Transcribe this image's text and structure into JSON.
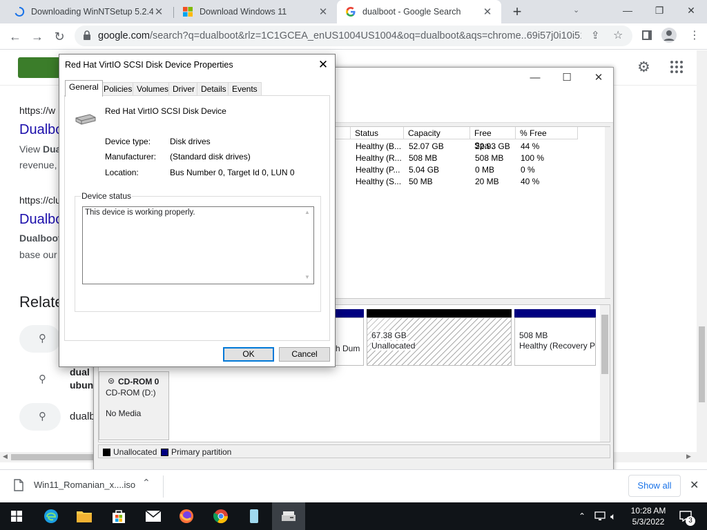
{
  "browser": {
    "tabs": [
      {
        "title": "Downloading WinNTSetup 5.2.4",
        "active": false
      },
      {
        "title": "Download Windows 11",
        "active": false
      },
      {
        "title": "dualboot - Google Search",
        "active": true
      }
    ],
    "window_controls": {
      "minimize": "—",
      "restore": "❐",
      "close": "✕"
    },
    "url": {
      "host": "google.com",
      "path": "/search?q=dualboot&rlz=1C1GCEA_enUS1004US1004&oq=dualboot&aqs=chrome..69i57j0i10i512j..."
    }
  },
  "google": {
    "results": [
      {
        "cite": "https://w",
        "title": "Dualbo",
        "snippet_bold": "Dua",
        "snippet_prefix": "View ",
        "snippet_line2": "revenue, "
      },
      {
        "cite": "https://clu",
        "title": "Dualbo",
        "snippet_bold": "Dualboot",
        "snippet_line2": "base our"
      }
    ],
    "related_heading": "Relate",
    "related": [
      {
        "line1": "",
        "line2": ""
      },
      {
        "line1": "dual",
        "line2": "ubun"
      },
      {
        "line1": "dualb",
        "line2": ""
      }
    ]
  },
  "disk_mgmt": {
    "columns": [
      "Status",
      "Capacity",
      "Free Spa...",
      "% Free"
    ],
    "rows": [
      [
        "Healthy (B...",
        "52.07 GB",
        "22.93 GB",
        "44 %"
      ],
      [
        "Healthy (R...",
        "508 MB",
        "508 MB",
        "100 %"
      ],
      [
        "Healthy (P...",
        "5.04 GB",
        "0 MB",
        "0 %"
      ],
      [
        "Healthy (S...",
        "50 MB",
        "20 MB",
        "40 %"
      ]
    ],
    "partition_fragment": "h Dum",
    "unallocated_block": {
      "size": "67.38 GB",
      "label": "Unallocated"
    },
    "recovery_block": {
      "size": "508 MB",
      "label": "Healthy (Recovery P"
    },
    "cdrom": {
      "name": "CD-ROM 0",
      "drive": "CD-ROM (D:)",
      "media": "No Media"
    },
    "legend": [
      {
        "label": "Unallocated",
        "color": "#000000"
      },
      {
        "label": "Primary partition",
        "color": "#000080"
      }
    ]
  },
  "dialog": {
    "title": "Red Hat VirtIO SCSI Disk Device Properties",
    "tabs": [
      "General",
      "Policies",
      "Volumes",
      "Driver",
      "Details",
      "Events"
    ],
    "device_name": "Red Hat VirtIO SCSI Disk Device",
    "fields": [
      {
        "label": "Device type:",
        "value": "Disk drives"
      },
      {
        "label": "Manufacturer:",
        "value": "(Standard disk drives)"
      },
      {
        "label": "Location:",
        "value": "Bus Number 0, Target Id 0, LUN 0"
      }
    ],
    "status_group_label": "Device status",
    "status_text": "This device is working properly.",
    "ok_label": "OK",
    "cancel_label": "Cancel"
  },
  "downloads": {
    "file": "Win11_Romanian_x....iso",
    "show_all": "Show all"
  },
  "taskbar": {
    "time": "10:28 AM",
    "date": "5/3/2022",
    "notification_count": "3"
  }
}
